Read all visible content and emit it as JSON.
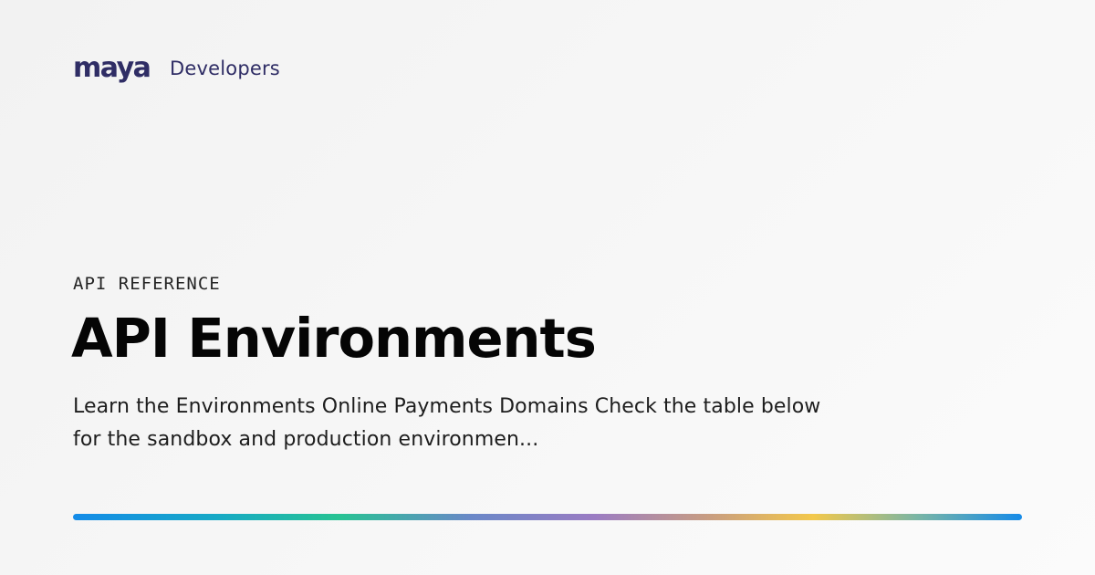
{
  "brand": {
    "logo_text": "maya",
    "product": "Developers",
    "brand_color": "#2f2d65"
  },
  "article": {
    "section": "API REFERENCE",
    "title": "API Environments",
    "description": "Learn the Environments Online Payments Domains Check the table below for the sandbox and production environmen..."
  },
  "accent_bar": {
    "colors": [
      "#148be8",
      "#16a9c6",
      "#27c393",
      "#6a88c8",
      "#9b7cc3",
      "#c89d81",
      "#f3c84b",
      "#79b5a5",
      "#168be8"
    ]
  }
}
